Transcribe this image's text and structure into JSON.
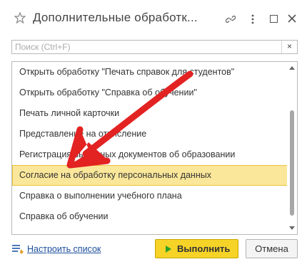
{
  "window": {
    "title": "Дополнительные обработк..."
  },
  "search": {
    "value": "",
    "placeholder": "Поиск (Ctrl+F)",
    "clear_label": "×"
  },
  "list": {
    "items": [
      {
        "label": "Открыть обработку \"Печать справок для студентов\""
      },
      {
        "label": "Открыть обработку \"Справка об обучении\""
      },
      {
        "label": "Печать личной карточки"
      },
      {
        "label": "Представление на отчисление"
      },
      {
        "label": "Регистрация выданных документов об образовании"
      },
      {
        "label": "Согласие на обработку персональных данных",
        "selected": true
      },
      {
        "label": "Справка о выполнении учебного плана"
      },
      {
        "label": "Справка об обучении"
      }
    ]
  },
  "footer": {
    "settings_label": "Настроить список",
    "run_label": "Выполнить",
    "cancel_label": "Отмена"
  },
  "colors": {
    "selected_row": "#fbe79a",
    "run_button": "#f6d327",
    "arrow": "#e32222",
    "link": "#1b4f9c"
  },
  "icons": [
    "star-icon",
    "link-icon",
    "more-icon",
    "maximize-icon",
    "close-icon",
    "settings-list-icon",
    "play-icon",
    "arrow-annotation"
  ]
}
